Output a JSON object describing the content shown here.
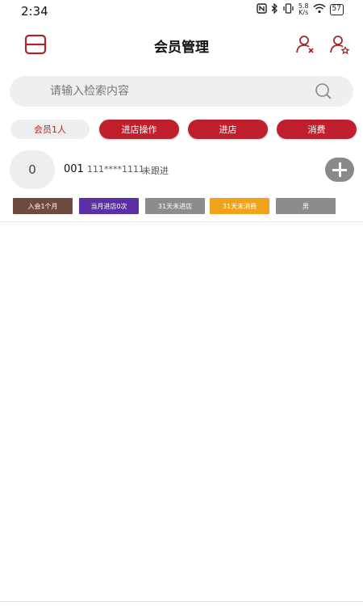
{
  "status_bar": {
    "time": "2:34",
    "speed_value": "5.8",
    "speed_unit": "K/s",
    "battery": "57"
  },
  "header": {
    "title": "会员管理",
    "menu_icon": "menu-icon",
    "icons": [
      "user-remove-icon",
      "user-star-icon"
    ]
  },
  "search": {
    "placeholder": "请输入检索内容",
    "value": ""
  },
  "actions": {
    "count_label": "会员1人",
    "enter_operation": "进店操作",
    "enter": "进店",
    "consume": "消费"
  },
  "member": {
    "avatar_text": "0",
    "id": "001",
    "phone": "111****1111",
    "status": "未跟进"
  },
  "tags": [
    {
      "label": "入会1个月",
      "color": "#6f4a3f"
    },
    {
      "label": "当月进店0次",
      "color": "#5b2fa5"
    },
    {
      "label": "31天未进店",
      "color": "#8c8c8c"
    },
    {
      "label": "31天未消费",
      "color": "#f0a21a"
    },
    {
      "label": "男",
      "color": "#8c8c8c"
    }
  ],
  "colors": {
    "accent": "#c0202e",
    "icon_brown": "#9b2a2a"
  }
}
